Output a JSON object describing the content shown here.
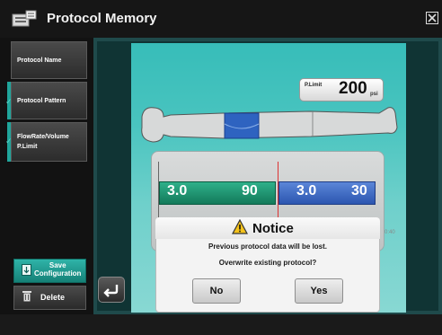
{
  "window": {
    "title": "Protocol Memory",
    "app_icon": "protocol-memory-icon",
    "close_icon": "close-icon"
  },
  "sidebar": {
    "items": [
      {
        "label": "Protocol Name",
        "checked": false
      },
      {
        "label": "Protocol Pattern",
        "checked": true
      },
      {
        "label_line1": "FlowRate/Volume",
        "label_line2": "P.Limit",
        "checked": true
      }
    ],
    "save_label_line1": "Save",
    "save_label_line2": "Configuration",
    "delete_label": "Delete"
  },
  "pressure_limit": {
    "label": "P.Limit",
    "value": "200",
    "unit": "psi"
  },
  "timeline": {
    "phases": [
      {
        "flow": "3.0",
        "volume": "90",
        "color": "#1f9a74"
      },
      {
        "flow": "3.0",
        "volume": "30",
        "color": "#3a6bc8"
      }
    ],
    "time_text": "0:40"
  },
  "dialog": {
    "title": "Notice",
    "line1": "Previous protocol data will be lost.",
    "line2": "Overwrite existing protocol?",
    "no_label": "No",
    "yes_label": "Yes"
  },
  "colors": {
    "accent": "#20a59b",
    "panel": "#3fbfba",
    "green_phase": "#1f9a74",
    "blue_phase": "#3a6bc8"
  }
}
